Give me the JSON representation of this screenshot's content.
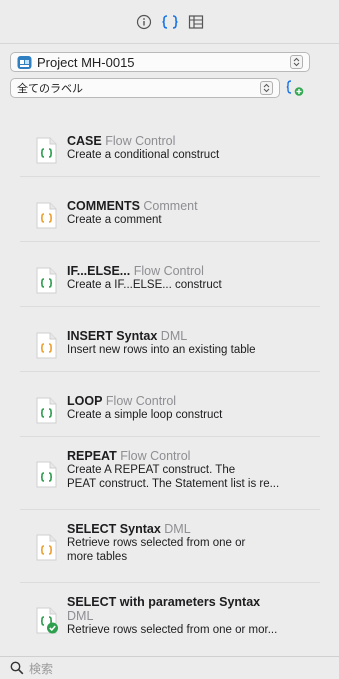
{
  "toolbar": {
    "icons": [
      "info-icon",
      "braces-icon",
      "columns-icon"
    ],
    "accent": "#1a73e8"
  },
  "project_selector": {
    "value": "Project MH-0015"
  },
  "label_selector": {
    "value": "全てのラベル"
  },
  "snippets": [
    {
      "name": "CASE",
      "category": "Flow Control",
      "desc": "Create a conditional construct",
      "icon": "green"
    },
    {
      "name": "COMMENTS",
      "category": "Comment",
      "desc": "Create a comment",
      "icon": "orange"
    },
    {
      "name": "IF...ELSE...",
      "category": "Flow Control",
      "desc": "Create a IF...ELSE... construct",
      "icon": "green"
    },
    {
      "name": "INSERT Syntax",
      "category": "DML",
      "desc": "Insert new rows into an existing table",
      "icon": "orange"
    },
    {
      "name": "LOOP",
      "category": "Flow Control",
      "desc": "Create a simple loop construct",
      "icon": "green"
    },
    {
      "name": "REPEAT",
      "category": "Flow Control",
      "desc1": "Create A REPEAT construct. The",
      "desc2": "PEAT construct. The Statement list is re...",
      "icon": "green"
    },
    {
      "name": "SELECT Syntax",
      "category": "DML",
      "desc1": "Retrieve rows selected from one or",
      "desc2": "more tables",
      "icon": "orange"
    },
    {
      "name": "SELECT with parameters Syntax",
      "category": "DML",
      "desc": "Retrieve rows selected from one or mor...",
      "icon": "green-check"
    }
  ],
  "search": {
    "placeholder": "検索"
  }
}
